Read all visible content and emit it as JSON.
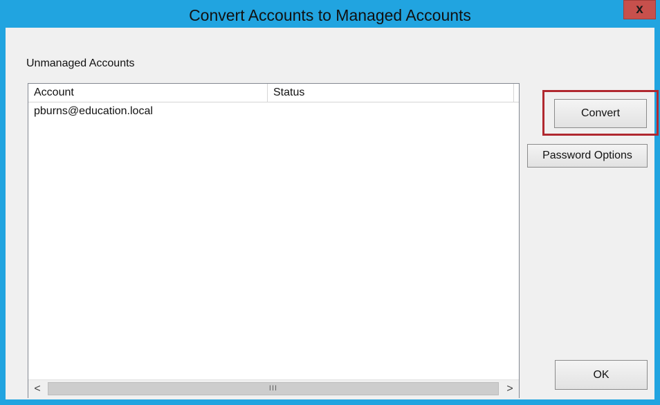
{
  "window": {
    "title": "Convert Accounts to Managed Accounts",
    "close_glyph": "x"
  },
  "group": {
    "label": "Unmanaged Accounts"
  },
  "table": {
    "columns": [
      "Account",
      "Status"
    ],
    "rows": [
      {
        "account": "pburns@education.local",
        "status": ""
      }
    ]
  },
  "scrollbar": {
    "left_arrow": "<",
    "right_arrow": ">",
    "thumb_grip": "III"
  },
  "buttons": {
    "convert": "Convert",
    "password_options": "Password Options",
    "ok": "OK"
  },
  "colors": {
    "frame": "#21a4e0",
    "close_button": "#c7504c",
    "highlight": "#b0282f"
  },
  "icons": {
    "close": "close-icon",
    "scroll_left": "chevron-left-icon",
    "scroll_right": "chevron-right-icon"
  }
}
